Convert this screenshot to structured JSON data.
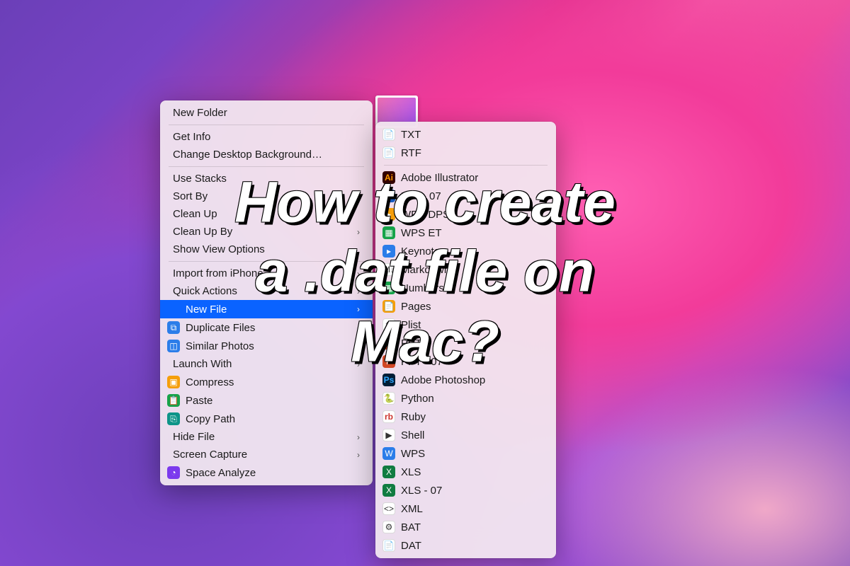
{
  "overlay": {
    "line1": "How to create",
    "line2": "a .dat file on",
    "line3": "Mac?"
  },
  "context_menu": {
    "new_folder": "New Folder",
    "get_info": "Get Info",
    "change_bg": "Change Desktop Background…",
    "use_stacks": "Use Stacks",
    "sort_by": "Sort By",
    "clean_up": "Clean Up",
    "clean_up_by": "Clean Up By",
    "show_view_options": "Show View Options",
    "import_iphone": "Import from iPhone",
    "quick_actions": "Quick Actions",
    "new_file": "New File",
    "duplicate_files": "Duplicate Files",
    "similar_photos": "Similar Photos",
    "launch_with": "Launch With",
    "compress": "Compress",
    "paste": "Paste",
    "copy_path": "Copy Path",
    "hide_file": "Hide File",
    "screen_capture": "Screen Capture",
    "space_analyze": "Space Analyze"
  },
  "submenu": {
    "txt": "TXT",
    "rtf": "RTF",
    "ai": "Adobe Illustrator",
    "doc07": "Doc - 07",
    "wps_dps": "WPS DPS",
    "wps_et": "WPS ET",
    "keynote": "Keynote",
    "markdown": "Markdown",
    "numbers": "Numbers",
    "pages": "Pages",
    "plist": "Plist",
    "ppt": "PPT",
    "ppt07": "PPT - 07",
    "psd": "Adobe Photoshop",
    "python": "Python",
    "ruby": "Ruby",
    "shell": "Shell",
    "wps": "WPS",
    "xls": "XLS",
    "xls07": "XLS - 07",
    "xml": "XML",
    "bat": "BAT",
    "dat": "DAT"
  }
}
